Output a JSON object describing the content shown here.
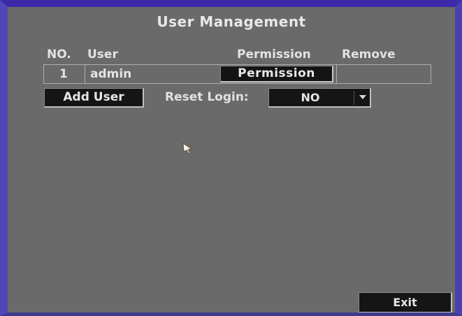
{
  "title": "User Management",
  "table": {
    "headers": {
      "no": "NO.",
      "user": "User",
      "permission": "Permission",
      "remove": "Remove"
    },
    "rows": [
      {
        "no": "1",
        "user": "admin",
        "permission_button": "Permission",
        "remove": ""
      }
    ]
  },
  "buttons": {
    "add_user": "Add User",
    "exit": "Exit"
  },
  "reset_login": {
    "label": "Reset Login:",
    "value": "NO"
  },
  "icons": {
    "cursor": "mouse-pointer-icon",
    "dropdown": "chevron-down-icon"
  },
  "colors": {
    "background": "#6a6a6a",
    "button": "#151515",
    "frame": "#4a40b0"
  }
}
